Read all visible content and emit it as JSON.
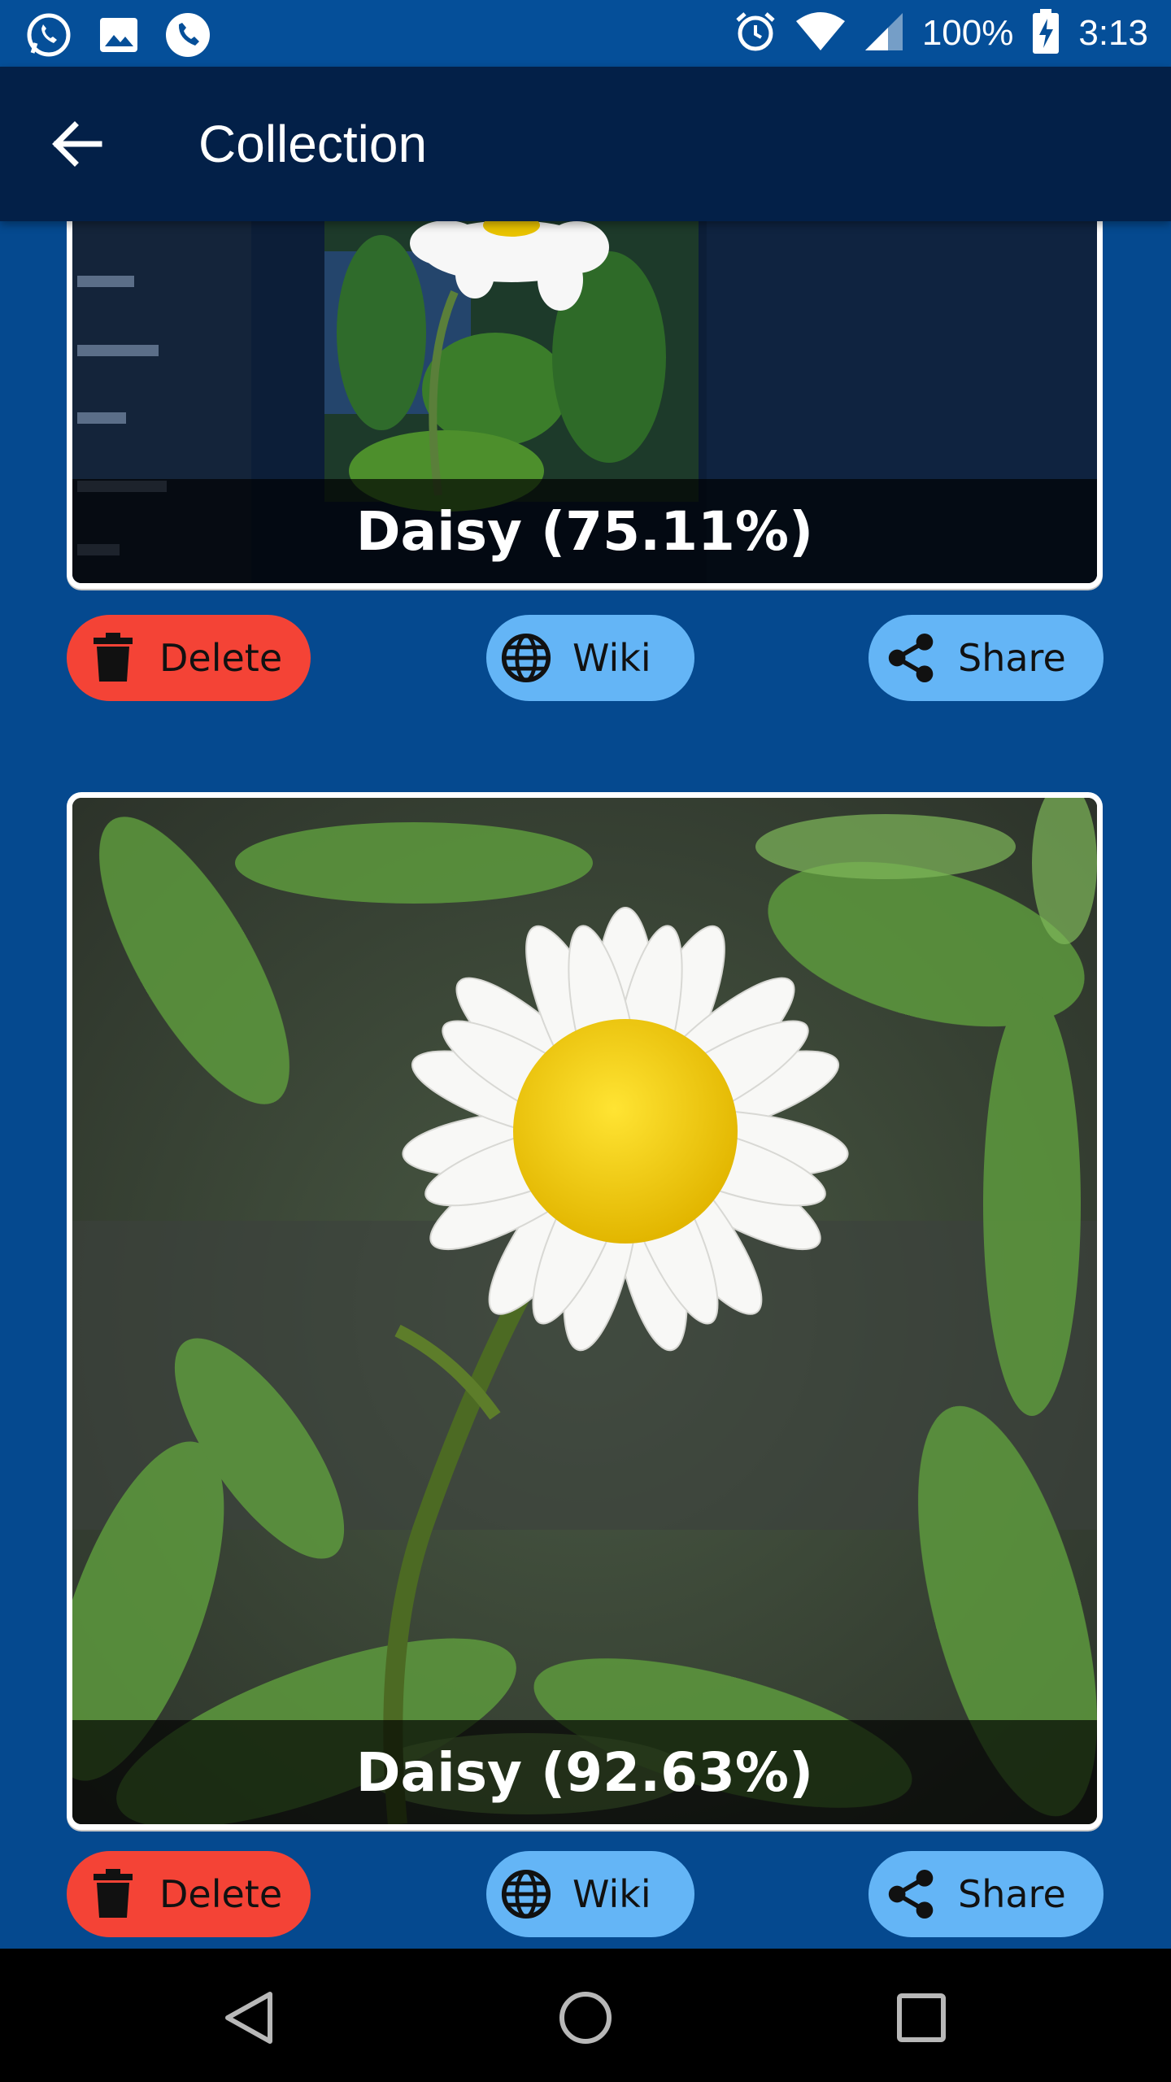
{
  "status_bar": {
    "battery": "100%",
    "time": "3:13",
    "icons": [
      "whatsapp-icon",
      "gallery-icon",
      "phone-icon",
      "alarm-icon",
      "wifi-icon",
      "signal-icon",
      "battery-charging-icon"
    ]
  },
  "app_bar": {
    "title": "Collection",
    "back_icon": "arrow-back-icon"
  },
  "cards": [
    {
      "caption": "Daisy (75.11%)",
      "actions": {
        "delete": "Delete",
        "wiki": "Wiki",
        "share": "Share"
      }
    },
    {
      "caption": "Daisy (92.63%)",
      "actions": {
        "delete": "Delete",
        "wiki": "Wiki",
        "share": "Share"
      }
    }
  ],
  "colors": {
    "background": "#05498f",
    "app_bar": "#032048",
    "delete_button": "#f44336",
    "wiki_button": "#64b5f6",
    "share_button": "#64b5f6"
  },
  "nav_bar": {
    "icons": [
      "back-triangle-icon",
      "home-circle-icon",
      "recents-square-icon"
    ]
  }
}
